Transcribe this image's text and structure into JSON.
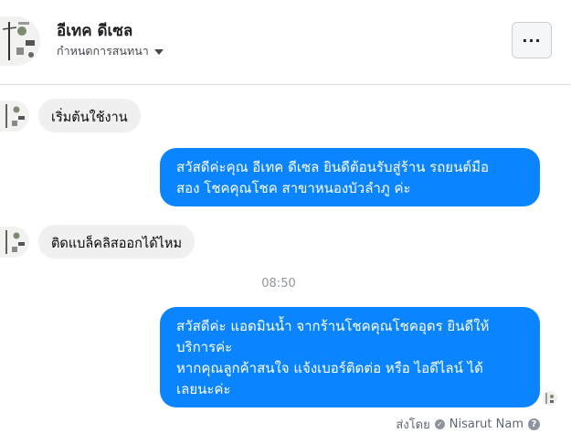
{
  "header": {
    "page_name": "อีเทค ดีเซล",
    "subtitle": "กำหนดการสนทนา",
    "more_label": "···"
  },
  "messages": [
    {
      "from": "customer",
      "text": "เริ่มต้นใช้งาน"
    },
    {
      "from": "page",
      "lines": [
        "สวัสดีค่ะคุณ อีเทค ดีเซล ยินดีต้อนรับสู่ร้าน รถยนต์มือ",
        "สอง โชคคุณโชค สาขาหนองบัวลำภู ค่ะ"
      ]
    },
    {
      "from": "customer",
      "text": "ติดแบล็คลิสออกได้ไหม"
    },
    {
      "from": "page",
      "lines": [
        "สวัสดีค่ะ แอดมินน้ำ จากร้านโชคคุณโชคอุดร ยินดีให้",
        "บริการค่ะ",
        "หากคุณลูกค้าสนใจ แจ้งเบอร์ติดต่อ หรือ ไอดีไลน์ ได้",
        "เลยนะค่ะ"
      ]
    }
  ],
  "timestamp": "08:50",
  "sent_by": {
    "label": "ส่งโดย",
    "name": "Nisarut Nam",
    "help": "?"
  },
  "colors": {
    "outgoing_bubble": "#0a84ff",
    "incoming_bubble": "#f0f0f0"
  },
  "icons": [
    "page-avatar-icon",
    "more-options-icon",
    "caret-down-icon",
    "verified-check-icon",
    "help-icon"
  ]
}
